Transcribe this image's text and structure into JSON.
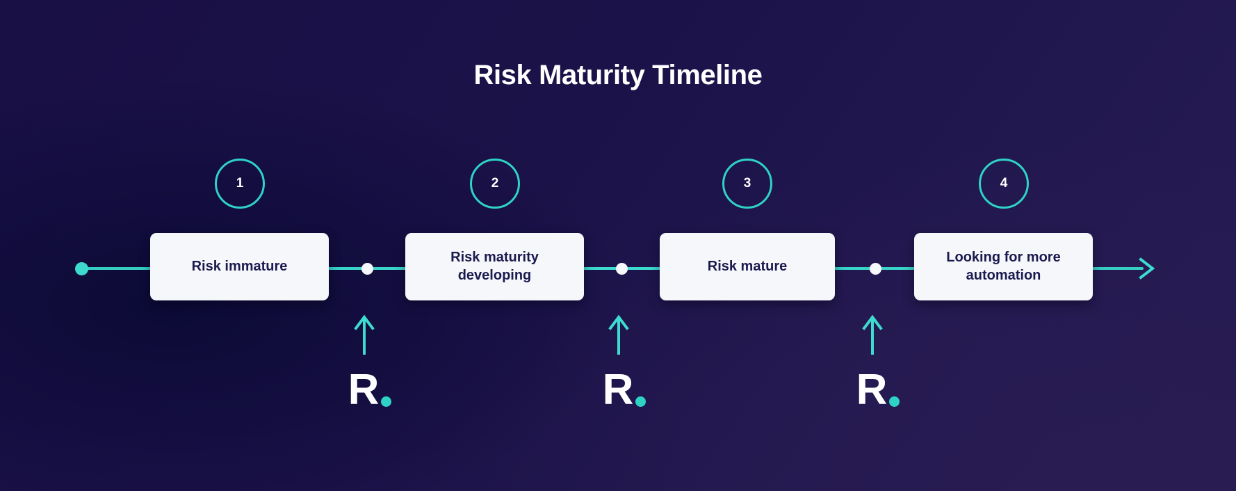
{
  "page": {
    "title": "Risk Maturity Timeline",
    "background_dark": "#191046",
    "background_light": "#271b53",
    "accent_teal": "#2fd3c6",
    "card_bg": "#f6f7fb",
    "card_text": "#1b1a4e",
    "title_color": "#ffffff"
  },
  "timeline": {
    "start_marker": "start-dot",
    "end_marker": "arrow-right",
    "steps": [
      {
        "number": "1",
        "label": "Risk immature"
      },
      {
        "number": "2",
        "label": "Risk maturity developing"
      },
      {
        "number": "3",
        "label": "Risk mature"
      },
      {
        "number": "4",
        "label": "Looking for more automation"
      }
    ],
    "connectors": [
      {
        "id": "connector-1-2"
      },
      {
        "id": "connector-2-3"
      },
      {
        "id": "connector-3-4"
      }
    ]
  },
  "markers": [
    {
      "id": "marker-1",
      "arrow": "arrow-up-icon",
      "logo_letter": "R",
      "logo_dot": "dot"
    },
    {
      "id": "marker-2",
      "arrow": "arrow-up-icon",
      "logo_letter": "R",
      "logo_dot": "dot"
    },
    {
      "id": "marker-3",
      "arrow": "arrow-up-icon",
      "logo_letter": "R",
      "logo_dot": "dot"
    }
  ]
}
